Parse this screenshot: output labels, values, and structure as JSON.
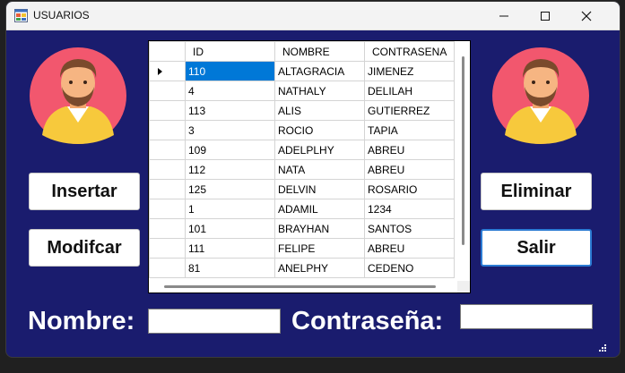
{
  "window": {
    "title": "USUARIOS"
  },
  "buttons": {
    "insertar": "Insertar",
    "modificar": "Modifcar",
    "eliminar": "Eliminar",
    "salir": "Salir"
  },
  "grid": {
    "columns": [
      "ID",
      "NOMBRE",
      "CONTRASENA"
    ],
    "selected_row": 0,
    "rows": [
      {
        "id": "110",
        "nombre": "ALTAGRACIA",
        "contrasena": "JIMENEZ"
      },
      {
        "id": "4",
        "nombre": "NATHALY",
        "contrasena": "DELILAH"
      },
      {
        "id": "113",
        "nombre": "ALIS",
        "contrasena": "GUTIERREZ"
      },
      {
        "id": "3",
        "nombre": "ROCIO",
        "contrasena": "TAPIA"
      },
      {
        "id": "109",
        "nombre": "ADELPLHY",
        "contrasena": "ABREU"
      },
      {
        "id": "112",
        "nombre": "NATA",
        "contrasena": "ABREU"
      },
      {
        "id": "125",
        "nombre": "DELVIN",
        "contrasena": "ROSARIO"
      },
      {
        "id": "1",
        "nombre": "ADAMIL",
        "contrasena": "1234"
      },
      {
        "id": "101",
        "nombre": "BRAYHAN",
        "contrasena": "SANTOS"
      },
      {
        "id": "111",
        "nombre": "FELIPE",
        "contrasena": "ABREU"
      },
      {
        "id": "81",
        "nombre": "ANELPHY",
        "contrasena": "CEDENO"
      }
    ]
  },
  "form": {
    "nombre_label": "Nombre:",
    "nombre_value": "",
    "contrasena_label": "Contraseña:",
    "contrasena_value": ""
  },
  "colors": {
    "background": "#1a1c6e",
    "selection": "#0078d7",
    "accent_border": "#2b7bd3"
  },
  "icons": [
    "app-form-icon",
    "minimize-icon",
    "maximize-icon",
    "close-icon",
    "user-avatar-icon",
    "row-selector-arrow-icon",
    "resize-grip-icon"
  ]
}
